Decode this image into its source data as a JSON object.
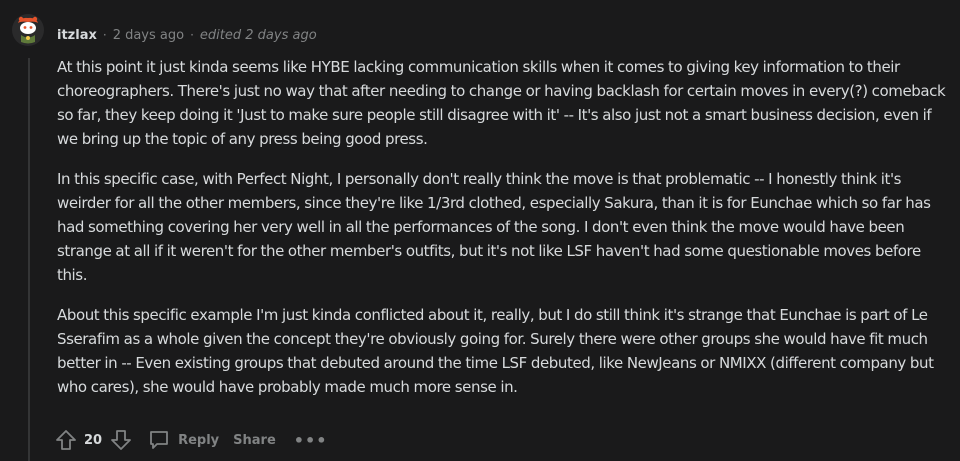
{
  "comment": {
    "author": "itzlax",
    "age": "2 days ago",
    "edited": "edited 2 days ago",
    "paragraphs": [
      "At this point it just kinda seems like HYBE lacking communication skills when it comes to giving key information to their choreographers. There's just no way that after needing to change or having backlash for certain moves in every(?) comeback so far, they keep doing it 'Just to make sure people still disagree with it' -- It's also just not a smart business decision, even if we bring up the topic of any press being good press.",
      "In this specific case, with Perfect Night, I personally don't really think the move is that problematic -- I honestly think it's weirder for all the other members, since they're like 1/3rd clothed, especially Sakura, than it is for Eunchae which so far has had something covering her very well in all the performances of the song. I don't even think the move would have been strange at all if it weren't for the other member's outfits, but it's not like LSF haven't had some questionable moves before this.",
      "About this specific example I'm just kinda conflicted about it, really, but I do still think it's strange that Eunchae is part of Le Sserafim as a whole given the concept they're obviously going for. Surely there were other groups she would have fit much better in -- Even existing groups that debuted around the time LSF debuted, like NewJeans or NMIXX (different company but who cares), she would have probably made much more sense in."
    ],
    "score": "20"
  },
  "actions": {
    "reply": "Reply",
    "share": "Share",
    "more": "•••"
  },
  "icons": {
    "avatar": "snoo-avatar-icon",
    "upvote": "upvote-arrow-icon",
    "downvote": "downvote-arrow-icon",
    "reply": "comment-bubble-icon",
    "more": "more-options-icon"
  },
  "colors": {
    "background": "#1a1a1b",
    "text": "#d7dadc",
    "muted": "#818384",
    "avatar_bg": "#e4532b"
  }
}
